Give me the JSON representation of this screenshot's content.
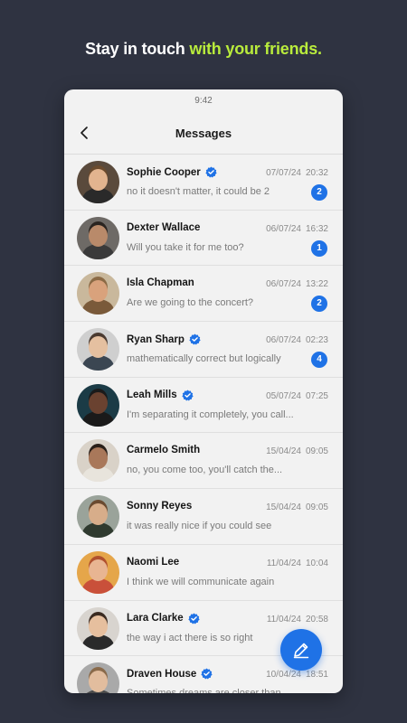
{
  "headline": {
    "part1": "Stay in touch ",
    "part2": "with your friends."
  },
  "status_bar": {
    "time": "9:42"
  },
  "nav": {
    "title": "Messages",
    "back_icon": "chevron-left-icon"
  },
  "fab": {
    "icon": "pencil-edit-icon"
  },
  "colors": {
    "accent": "#b9ec3c",
    "primary": "#1f72e6",
    "background": "#2f3341"
  },
  "conversations": [
    {
      "name": "Sophie Cooper",
      "verified": true,
      "date": "07/07/24",
      "time": "20:32",
      "preview": "no it doesn't matter, it could be 2",
      "unread": "2",
      "avatar": {
        "bg": "#5a4a3c",
        "skin": "#e2b48f",
        "shirt": "#2a2a2a",
        "hair": "#6b4b2e"
      }
    },
    {
      "name": "Dexter Wallace",
      "verified": false,
      "date": "06/07/24",
      "time": "16:32",
      "preview": "Will you take it for me too?",
      "unread": "1",
      "avatar": {
        "bg": "#6e6a66",
        "skin": "#b98a6a",
        "shirt": "#3a3a3a",
        "hair": "#2a2420"
      }
    },
    {
      "name": "Isla Chapman",
      "verified": false,
      "date": "06/07/24",
      "time": "13:22",
      "preview": "Are we going to the concert?",
      "unread": "2",
      "avatar": {
        "bg": "#c9b89c",
        "skin": "#d9a27c",
        "shirt": "#7a5a3a",
        "hair": "#8b6a45"
      }
    },
    {
      "name": "Ryan Sharp",
      "verified": true,
      "date": "06/07/24",
      "time": "02:23",
      "preview": "mathematically correct but logically",
      "unread": "4",
      "avatar": {
        "bg": "#cfcfcf",
        "skin": "#e5c0a0",
        "shirt": "#3b4652",
        "hair": "#4a3a30"
      }
    },
    {
      "name": "Leah Mills",
      "verified": true,
      "date": "05/07/24",
      "time": "07:25",
      "preview": "I'm separating it completely, you call...",
      "unread": "",
      "avatar": {
        "bg": "#1b3b46",
        "skin": "#6a4230",
        "shirt": "#1a1a1a",
        "hair": "#1a1a1a"
      }
    },
    {
      "name": "Carmelo Smith",
      "verified": false,
      "date": "15/04/24",
      "time": "09:05",
      "preview": "no, you come too, you'll catch the...",
      "unread": "",
      "avatar": {
        "bg": "#d9d2c8",
        "skin": "#a9785a",
        "shirt": "#e8e4dc",
        "hair": "#2a1f18"
      }
    },
    {
      "name": "Sonny Reyes",
      "verified": false,
      "date": "15/04/24",
      "time": "09:05",
      "preview": "it was really nice if you could see",
      "unread": "",
      "avatar": {
        "bg": "#9aa39a",
        "skin": "#d7ad8a",
        "shirt": "#2f3a2f",
        "hair": "#6a4a30"
      }
    },
    {
      "name": "Naomi Lee",
      "verified": false,
      "date": "11/04/24",
      "time": "10:04",
      "preview": "I think we will communicate again",
      "unread": "",
      "avatar": {
        "bg": "#e5a64a",
        "skin": "#e8b592",
        "shirt": "#c9503a",
        "hair": "#b0502e"
      }
    },
    {
      "name": "Lara Clarke",
      "verified": true,
      "date": "11/04/24",
      "time": "20:58",
      "preview": "the way i act there is so right",
      "unread": "",
      "avatar": {
        "bg": "#d8d4cf",
        "skin": "#e6bf9e",
        "shirt": "#2a2a2a",
        "hair": "#3a2a20"
      }
    },
    {
      "name": "Draven House",
      "verified": true,
      "date": "10/04/24",
      "time": "18:51",
      "preview": "Sometimes dreams are closer than...",
      "unread": "",
      "avatar": {
        "bg": "#a9a9a9",
        "skin": "#e2bd9e",
        "shirt": "#4a4a4a",
        "hair": "#8a6a4a"
      }
    }
  ]
}
